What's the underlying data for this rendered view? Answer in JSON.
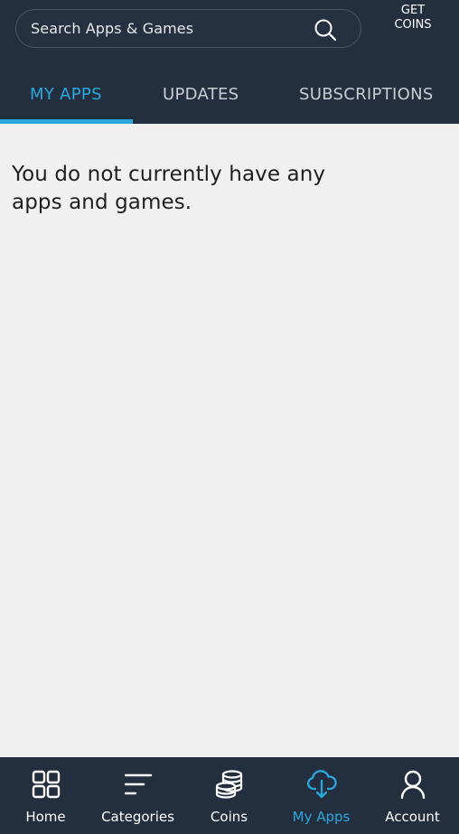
{
  "search": {
    "placeholder": "Search Apps & Games"
  },
  "header": {
    "get_coins_line1": "GET",
    "get_coins_line2": "COINS"
  },
  "tabs": [
    {
      "label": "MY APPS",
      "active": true
    },
    {
      "label": "UPDATES",
      "active": false
    },
    {
      "label": "SUBSCRIPTIONS",
      "active": false
    }
  ],
  "content": {
    "empty_message": "You do not currently have any apps and games."
  },
  "bottom_nav": [
    {
      "label": "Home",
      "icon": "home-grid-icon",
      "active": false
    },
    {
      "label": "Categories",
      "icon": "categories-list-icon",
      "active": false
    },
    {
      "label": "Coins",
      "icon": "coins-stack-icon",
      "active": false
    },
    {
      "label": "My Apps",
      "icon": "cloud-download-icon",
      "active": true
    },
    {
      "label": "Account",
      "icon": "account-person-icon",
      "active": false
    }
  ],
  "colors": {
    "header_bg": "#232f3e",
    "accent": "#2aa8de",
    "content_bg": "#f0f0f0"
  }
}
